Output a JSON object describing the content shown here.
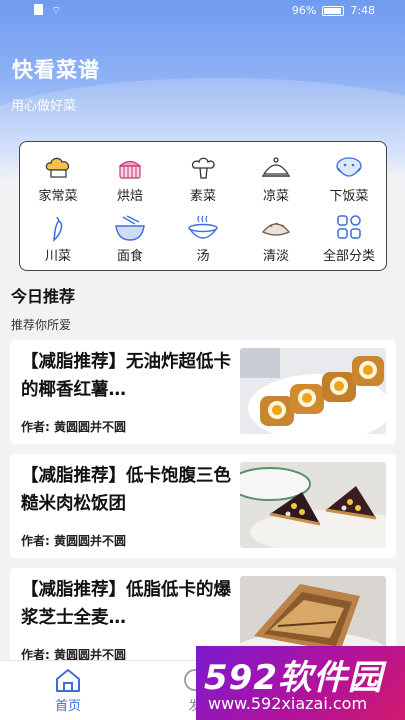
{
  "status_bar": {
    "battery": "96%",
    "time": "7:48"
  },
  "header": {
    "title": "快看菜谱",
    "subtitle": "用心做好菜"
  },
  "categories": [
    {
      "label": "家常菜",
      "icon": "chef-hat-icon"
    },
    {
      "label": "烘焙",
      "icon": "cake-icon"
    },
    {
      "label": "素菜",
      "icon": "broccoli-icon"
    },
    {
      "label": "凉菜",
      "icon": "dish-cover-icon"
    },
    {
      "label": "下饭菜",
      "icon": "bowl-icon"
    },
    {
      "label": "川菜",
      "icon": "chili-icon"
    },
    {
      "label": "面食",
      "icon": "noodle-bowl-icon"
    },
    {
      "label": "汤",
      "icon": "soup-icon"
    },
    {
      "label": "清淡",
      "icon": "dumpling-icon"
    },
    {
      "label": "全部分类",
      "icon": "grid-icon"
    }
  ],
  "section": {
    "title": "今日推荐",
    "subtitle": "推荐你所爱"
  },
  "recipes": [
    {
      "title": "【减脂推荐】无油炸超低卡的椰香红薯…",
      "author": "作者: 黄圆圆并不圆"
    },
    {
      "title": "【减脂推荐】低卡饱腹三色糙米肉松饭团",
      "author": "作者: 黄圆圆并不圆"
    },
    {
      "title": "【减脂推荐】低脂低卡的爆浆芝士全麦…",
      "author": "作者: 黄圆圆并不圆"
    }
  ],
  "tabbar": {
    "home": "首页",
    "publish": "发"
  },
  "watermark": {
    "brand": "592软件园",
    "url": "www.592xiazai.com"
  },
  "colors": {
    "accent": "#3d6fdc",
    "hero": "#6f9bf0"
  }
}
